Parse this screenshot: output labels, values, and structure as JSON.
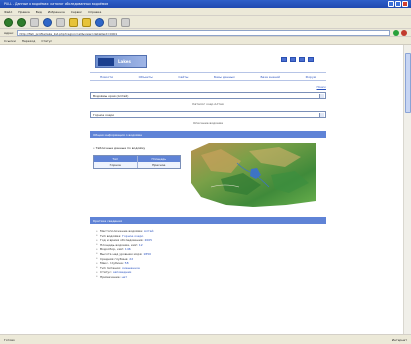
{
  "window": {
    "title": "PULL - Данные о водоёмах: каталог обследованных водоёмов"
  },
  "menu": [
    "Файл",
    "Правка",
    "Вид",
    "Избранное",
    "Сервис",
    "Справка"
  ],
  "toolbar": {
    "icons": [
      "back-icon",
      "forward-icon",
      "stop-icon",
      "refresh-icon",
      "home-icon",
      "search-icon",
      "favorites-icon",
      "history-icon",
      "mail-icon",
      "print-icon"
    ]
  },
  "address": {
    "label": "Адрес",
    "url": "http://fish_profile/lake_list.php?region=all&view=detail&id=0001"
  },
  "links_bar": [
    "Ссылки",
    "Переход",
    "Статус"
  ],
  "page": {
    "logo_text": "Lakes",
    "nav": [
      "Новости",
      "Объекты",
      "Сайты",
      "Базы данных",
      "База знаний",
      "Форум"
    ],
    "small_link": "Поиск",
    "select1": "Водоёмы края (Алтай)",
    "center_label1": "Каталог озер Алтая",
    "select2": "Горное озеро",
    "center_label2": "Описание водоема",
    "band_title": "Общая информация о водоёме",
    "note": "• Табличные данные по водоёму",
    "table": {
      "headers": [
        "Тип",
        "Площадь"
      ],
      "rows": [
        [
          "Горное",
          "Пресное"
        ]
      ]
    },
    "band2_title": "Краткие сведения",
    "details": [
      {
        "label": "Местоположение водоёма:",
        "value": "Алтай"
      },
      {
        "label": "Тип водоёма:",
        "value": "Горное озеро"
      },
      {
        "label": "Год и время обследования:",
        "value": "2005"
      },
      {
        "label": "Площадь водоема, км2:",
        "value": "12"
      },
      {
        "label": "Водосбор, км2:",
        "value": "146"
      },
      {
        "label": "Высота над уровнем моря:",
        "value": "1850"
      },
      {
        "label": "Средняя глубина:",
        "value": "22"
      },
      {
        "label": "Макс. глубина:",
        "value": "58"
      },
      {
        "label": "Тип питания:",
        "value": "смешанное"
      },
      {
        "label": "Статус:",
        "value": "заповедник"
      },
      {
        "label": "Примечание:",
        "value": "нет"
      }
    ]
  },
  "status": {
    "left": "Готово",
    "right": "Интернет"
  }
}
